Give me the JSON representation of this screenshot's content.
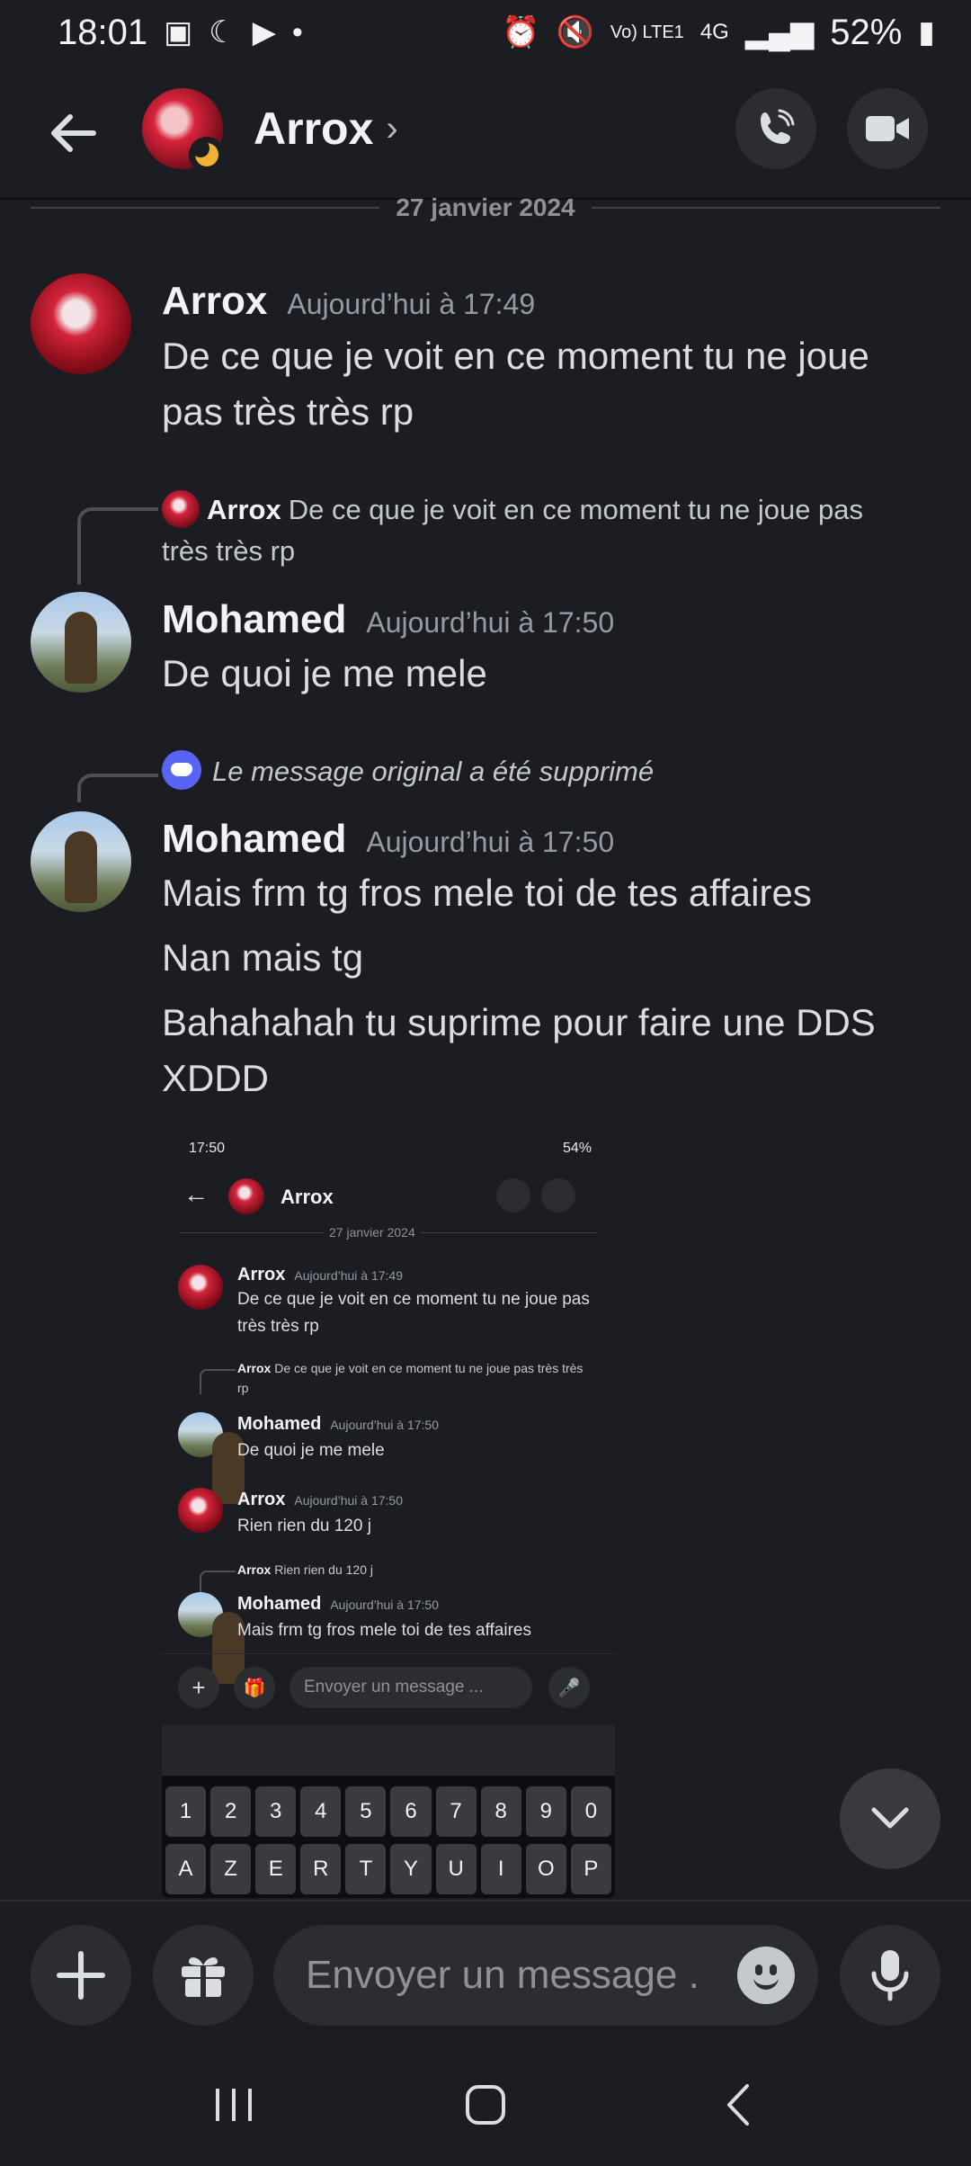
{
  "status_bar": {
    "time": "18:01",
    "battery": "52%",
    "network": "4G",
    "volte": "Vo) LTE1"
  },
  "header": {
    "contact_name": "Arrox"
  },
  "date_divider": "27 janvier 2024",
  "messages": [
    {
      "author": "Arrox",
      "time": "Aujourd’hui à 17:49",
      "lines": [
        "De ce que je voit en ce moment tu ne joue pas très très rp"
      ]
    },
    {
      "reply": {
        "author": "Arrox",
        "text": "De ce que je voit en ce moment tu ne joue pas très très rp"
      },
      "author": "Mohamed",
      "time": "Aujourd’hui à 17:50",
      "lines": [
        "De quoi je me mele"
      ]
    },
    {
      "reply_deleted": "Le message original a été supprimé",
      "author": "Mohamed",
      "time": "Aujourd’hui à 17:50",
      "lines": [
        "Mais frm tg fros mele toi de tes affaires",
        "Nan mais tg",
        "Bahahahah tu suprime pour faire une DDS XDDD"
      ]
    }
  ],
  "attachment": {
    "status_time": "17:50",
    "status_right": "54%",
    "contact_name": "Arrox",
    "date_divider": "27 janvier 2024",
    "messages": [
      {
        "author": "Arrox",
        "time": "Aujourd’hui à 17:49",
        "text": "De ce que je voit en ce moment tu ne joue pas très très rp"
      },
      {
        "reply_author": "Arrox",
        "reply_text": "De ce que je voit en ce moment tu ne joue pas très très rp",
        "author": "Mohamed",
        "time": "Aujourd’hui à 17:50",
        "text": "De quoi je me mele"
      },
      {
        "author": "Arrox",
        "time": "Aujourd’hui à 17:50",
        "text": "Rien rien du 120 j"
      },
      {
        "reply_author": "Arrox",
        "reply_text": "Rien rien du 120 j",
        "author": "Mohamed",
        "time": "Aujourd’hui à 17:50",
        "text": "Mais frm tg fros mele toi de tes affaires"
      }
    ],
    "input_placeholder": "Envoyer un message ...",
    "keyboard_numbers": [
      "1",
      "2",
      "3",
      "4",
      "5",
      "6",
      "7",
      "8",
      "9",
      "0"
    ],
    "keyboard_letters": [
      "A",
      "Z",
      "E",
      "R",
      "T",
      "Y",
      "U",
      "I",
      "O",
      "P"
    ]
  },
  "input": {
    "placeholder": "Envoyer un message ..."
  },
  "colors": {
    "background": "#1c1d22",
    "surface": "#2b2d31",
    "blurple": "#5865f2",
    "idle": "#f0b232"
  }
}
